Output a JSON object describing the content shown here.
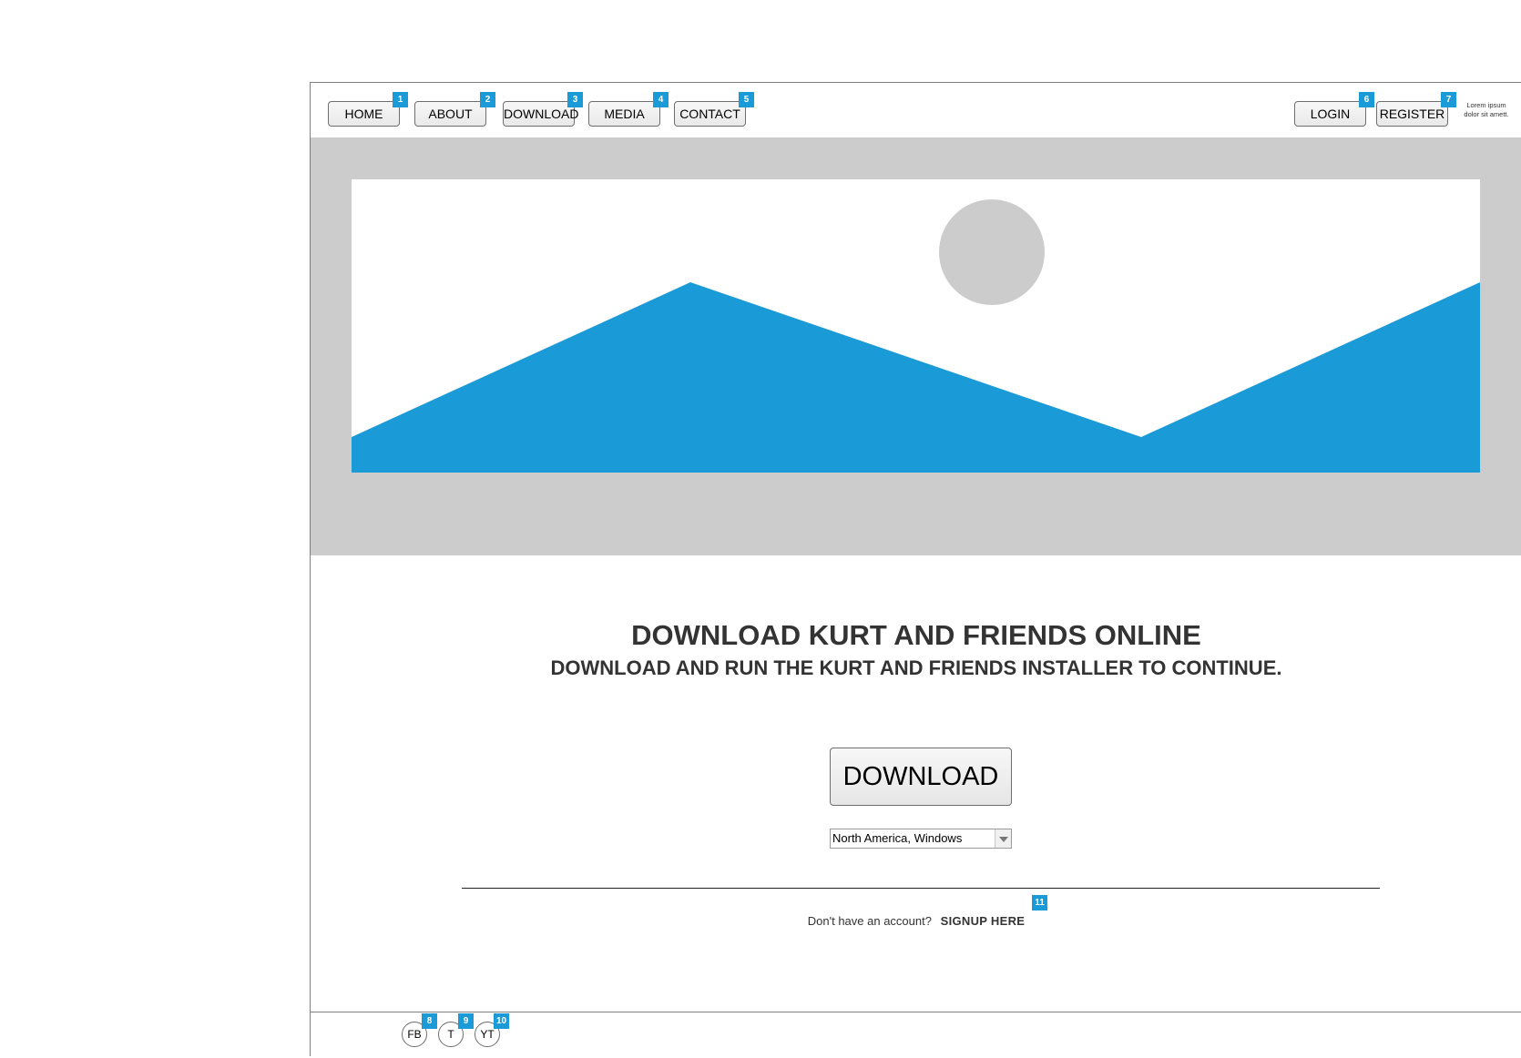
{
  "nav": {
    "items": [
      {
        "label": "HOME",
        "badge": "1"
      },
      {
        "label": "ABOUT",
        "badge": "2"
      },
      {
        "label": "DOWNLOAD",
        "badge": "3"
      },
      {
        "label": "MEDIA",
        "badge": "4"
      },
      {
        "label": "CONTACT",
        "badge": "5"
      }
    ],
    "login": {
      "label": "LOGIN",
      "badge": "6"
    },
    "register": {
      "label": "REGISTER",
      "badge": "7"
    },
    "side_text": "Lorem ipsum dolor sit amett."
  },
  "hero": {
    "image_icon": "image-placeholder-icon",
    "band_color": "#cccccc",
    "mountain_color": "#1a9ad6",
    "sun_color": "#cccccc"
  },
  "main": {
    "title": "DOWNLOAD KURT AND FRIENDS ONLINE",
    "subtitle": "DOWNLOAD AND RUN THE KURT AND FRIENDS INSTALLER TO CONTINUE.",
    "download_label": "DOWNLOAD",
    "region_select": "North America, Windows",
    "signup_prompt": "Don't have an account?",
    "signup_link": "SIGNUP HERE",
    "signup_badge": "11"
  },
  "footer": {
    "social": [
      {
        "label": "FB",
        "badge": "8"
      },
      {
        "label": "T",
        "badge": "9"
      },
      {
        "label": "YT",
        "badge": "10"
      }
    ]
  },
  "accent_color": "#1a9ad6"
}
